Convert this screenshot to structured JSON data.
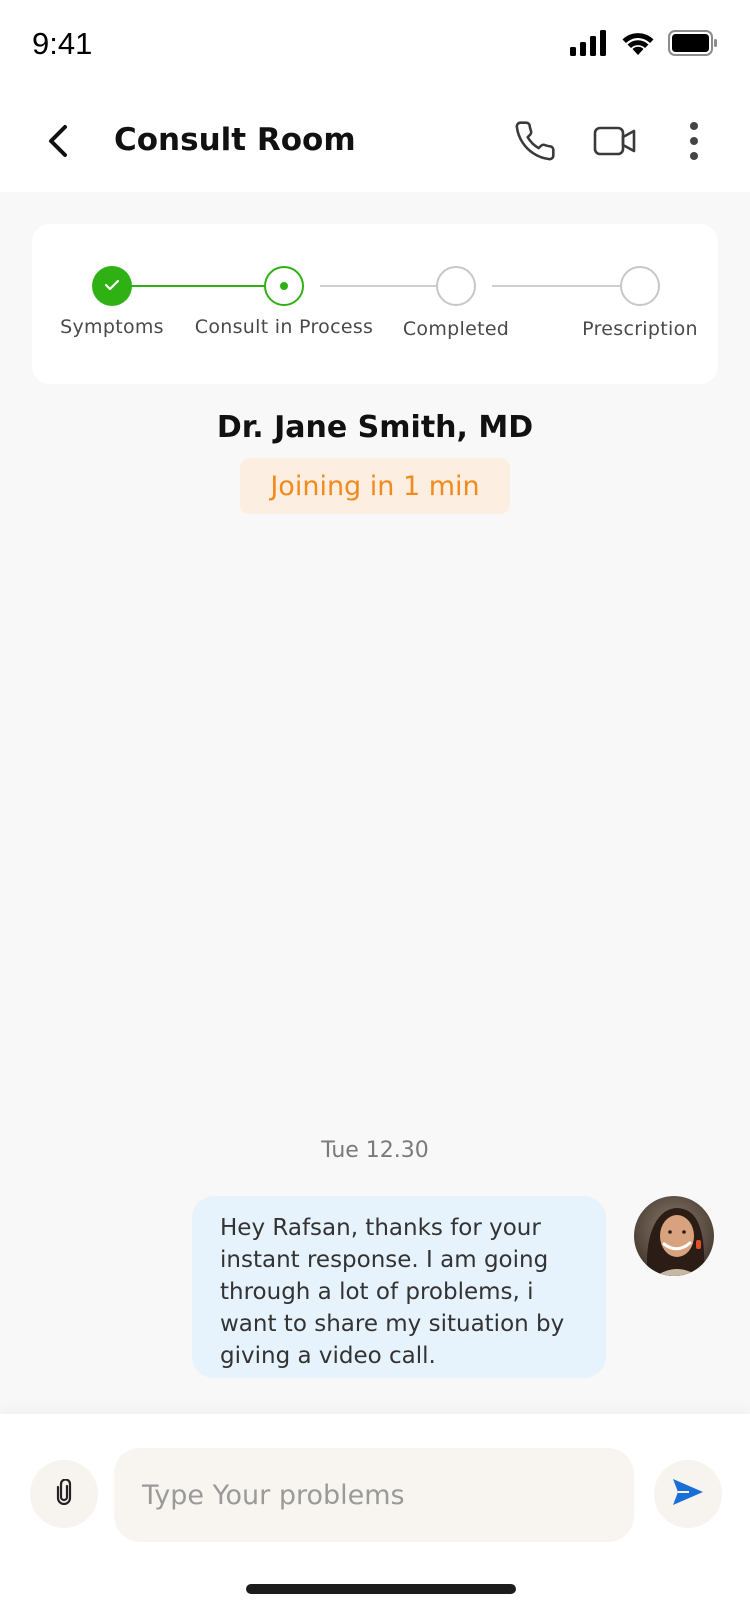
{
  "status_bar": {
    "time": "9:41",
    "icons": [
      "cellular-signal-icon",
      "wifi-icon",
      "battery-icon"
    ]
  },
  "header": {
    "title": "Consult Room",
    "back_icon": "chevron-left-icon",
    "actions": [
      "phone-icon",
      "video-camera-icon",
      "more-vertical-icon"
    ]
  },
  "progress": {
    "steps": [
      {
        "label": "Symptoms",
        "state": "done"
      },
      {
        "label": "Consult in Process",
        "state": "active"
      },
      {
        "label": "Completed",
        "state": "pending"
      },
      {
        "label": "Prescription",
        "state": "pending"
      }
    ],
    "colors": {
      "done": "#2fb114",
      "active": "#2fb114",
      "pending": "#c8c8c8"
    }
  },
  "doctor": {
    "name": "Dr. Jane Smith, MD",
    "status": "Joining in 1 min"
  },
  "chat": {
    "day_label": "Tue 12.30",
    "messages": [
      {
        "text": "Hey Rafsan, thanks for your instant response. I am going through a lot of problems, i want to share my situation by giving a video call."
      }
    ]
  },
  "composer": {
    "placeholder": "Type Your problems",
    "attach_icon": "paperclip-icon",
    "send_icon": "send-icon",
    "send_color": "#1a6fd6"
  },
  "colors": {
    "accent_green": "#2fb114",
    "badge_bg": "#fdeee2",
    "badge_text": "#f28a1c",
    "bubble_bg": "#e6f3fc"
  }
}
